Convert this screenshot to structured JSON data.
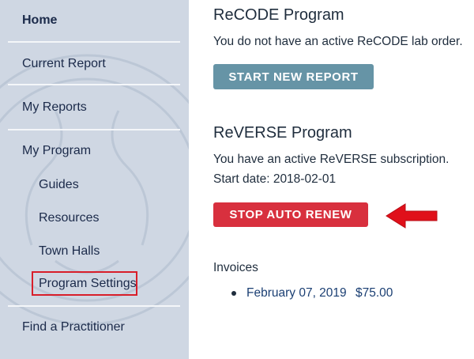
{
  "sidebar": {
    "items": [
      {
        "label": "Home"
      },
      {
        "label": "Current Report"
      },
      {
        "label": "My Reports"
      },
      {
        "label": "My Program"
      },
      {
        "label": "Guides"
      },
      {
        "label": "Resources"
      },
      {
        "label": "Town Halls"
      },
      {
        "label": "Program Settings"
      },
      {
        "label": "Find a Practitioner"
      }
    ]
  },
  "recode": {
    "title": "ReCODE Program",
    "message": "You do not have an active ReCODE lab order.",
    "button_label": "START NEW REPORT"
  },
  "reverse": {
    "title": "ReVERSE Program",
    "message": "You have an active ReVERSE subscription.",
    "start_date": "Start date: 2018-02-01",
    "button_label": "STOP AUTO RENEW"
  },
  "invoices": {
    "heading": "Invoices",
    "items": [
      {
        "date": "February 07, 2019",
        "amount": "$75.00"
      }
    ]
  },
  "colors": {
    "sidebar_bg": "#cfd7e3",
    "start_button": "#6694a6",
    "stop_button": "#d8303e",
    "annotation_red": "#d81e2a"
  }
}
